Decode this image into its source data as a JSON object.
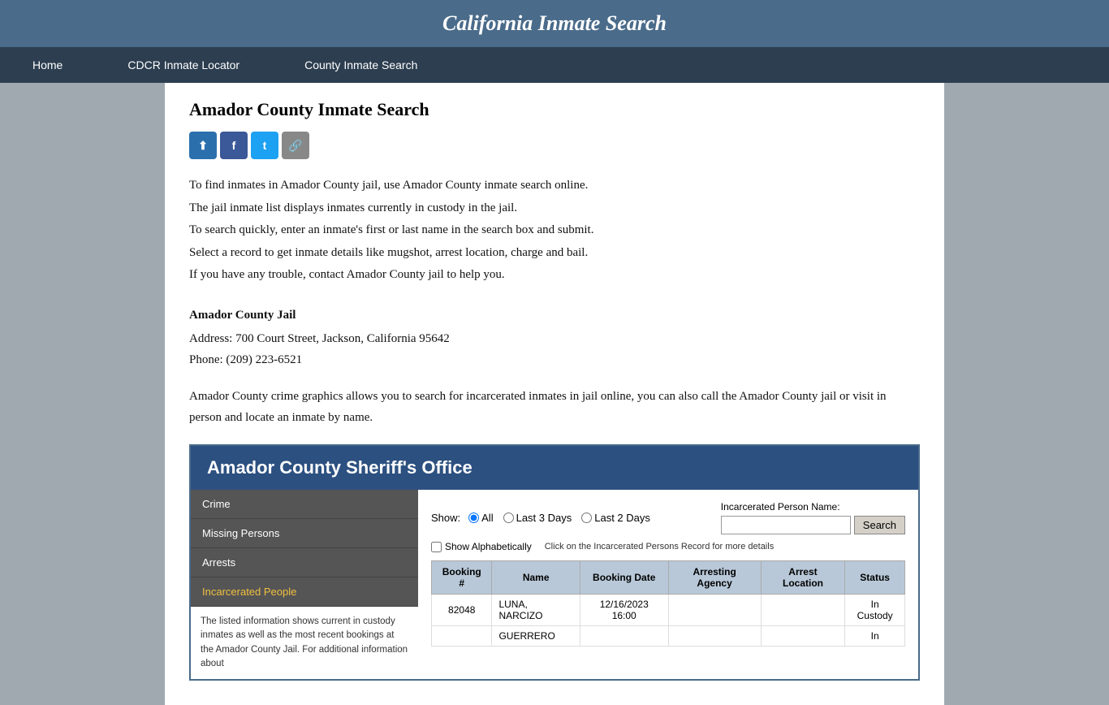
{
  "header": {
    "title": "California Inmate Search"
  },
  "nav": {
    "items": [
      {
        "label": "Home",
        "id": "home"
      },
      {
        "label": "CDCR Inmate Locator",
        "id": "cdcr"
      },
      {
        "label": "County Inmate Search",
        "id": "county"
      }
    ]
  },
  "page": {
    "title": "Amador County Inmate Search",
    "description": [
      "To find inmates in Amador County jail, use Amador County inmate search online.",
      "The jail inmate list displays inmates currently in custody in the jail.",
      "To search quickly, enter an inmate's first or last name in the search box and submit.",
      "Select a record to get inmate details like mugshot, arrest location, charge and bail.",
      "If you have any trouble, contact Amador County jail to help you."
    ],
    "jail_section": {
      "title": "Amador County Jail",
      "address": "Address: 700 Court Street, Jackson, California 95642",
      "phone": "Phone: (209) 223-6521"
    },
    "bottom_desc": "Amador County crime graphics allows you to search for incarcerated inmates in jail online, you can also call the Amador County jail or visit in person and locate an inmate by name."
  },
  "social": {
    "share_label": "Share",
    "facebook_label": "f",
    "twitter_label": "t",
    "link_label": "🔗"
  },
  "embedded": {
    "sheriff_title": "Amador County Sheriff's Office",
    "sidebar_items": [
      {
        "label": "Crime",
        "id": "crime",
        "active": false
      },
      {
        "label": "Missing Persons",
        "id": "missing",
        "active": false
      },
      {
        "label": "Arrests",
        "id": "arrests",
        "active": false
      },
      {
        "label": "Incarcerated People",
        "id": "incarcerated",
        "active": true
      }
    ],
    "sidebar_notice": "The listed information shows current in custody inmates as well as the most recent bookings at the Amador County Jail. For additional information about",
    "filter": {
      "show_label": "Show:",
      "options": [
        {
          "label": "All",
          "value": "all",
          "checked": true
        },
        {
          "label": "Last 3 Days",
          "value": "3days",
          "checked": false
        },
        {
          "label": "Last 2 Days",
          "value": "2days",
          "checked": false
        }
      ],
      "name_label": "Incarcerated Person Name:",
      "name_placeholder": "",
      "search_button": "Search"
    },
    "alpha_label": "Show Alphabetically",
    "click_note": "Click on the Incarcerated Persons Record for more details",
    "table": {
      "headers": [
        "Booking #",
        "Name",
        "Booking Date",
        "Arresting Agency",
        "Arrest Location",
        "Status"
      ],
      "rows": [
        {
          "booking": "82048",
          "name": "LUNA, NARCIZO",
          "booking_date": "12/16/2023 16:00",
          "arresting_agency": "",
          "arrest_location": "",
          "status": "In Custody"
        },
        {
          "booking": "",
          "name": "GUERRERO",
          "booking_date": "",
          "arresting_agency": "",
          "arrest_location": "",
          "status": "In"
        }
      ]
    }
  }
}
